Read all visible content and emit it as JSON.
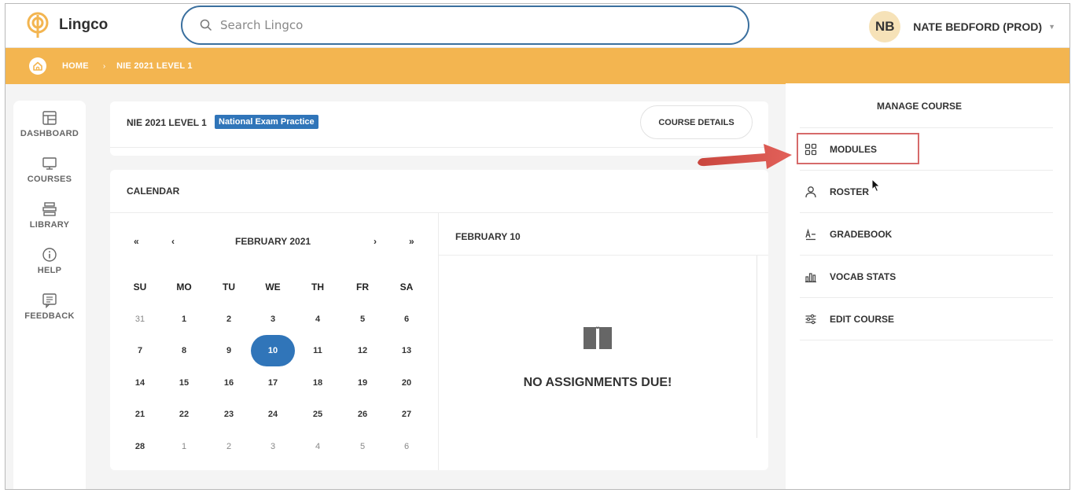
{
  "app": {
    "name": "Lingco"
  },
  "search": {
    "placeholder": "Search Lingco"
  },
  "user": {
    "initials": "NB",
    "name": "NATE BEDFORD (PROD)"
  },
  "breadcrumb": {
    "home": "HOME",
    "current": "NIE 2021 LEVEL 1"
  },
  "sidebar": {
    "items": [
      {
        "label": "DASHBOARD",
        "icon": "dashboard-icon"
      },
      {
        "label": "COURSES",
        "icon": "courses-icon"
      },
      {
        "label": "LIBRARY",
        "icon": "library-icon"
      },
      {
        "label": "HELP",
        "icon": "help-icon"
      },
      {
        "label": "FEEDBACK",
        "icon": "feedback-icon"
      }
    ]
  },
  "course": {
    "title": "NIE 2021 LEVEL 1",
    "badge": "National Exam Practice",
    "details_button": "COURSE DETAILS"
  },
  "calendar": {
    "title": "CALENDAR",
    "month": "FEBRUARY 2021",
    "nav": {
      "first": "«",
      "prev": "‹",
      "next": "›",
      "last": "»"
    },
    "weekdays": [
      "SU",
      "MO",
      "TU",
      "WE",
      "TH",
      "FR",
      "SA"
    ],
    "weeks": [
      [
        "31",
        "1",
        "2",
        "3",
        "4",
        "5",
        "6"
      ],
      [
        "7",
        "8",
        "9",
        "10",
        "11",
        "12",
        "13"
      ],
      [
        "14",
        "15",
        "16",
        "17",
        "18",
        "19",
        "20"
      ],
      [
        "21",
        "22",
        "23",
        "24",
        "25",
        "26",
        "27"
      ],
      [
        "28",
        "1",
        "2",
        "3",
        "4",
        "5",
        "6"
      ]
    ],
    "selected_date": "10",
    "selected_title": "FEBRUARY 10",
    "empty_message": "NO ASSIGNMENTS DUE!"
  },
  "manage": {
    "title": "MANAGE COURSE",
    "items": [
      {
        "label": "MODULES",
        "icon": "modules-icon"
      },
      {
        "label": "ROSTER",
        "icon": "roster-icon"
      },
      {
        "label": "GRADEBOOK",
        "icon": "gradebook-icon"
      },
      {
        "label": "VOCAB STATS",
        "icon": "vocab-stats-icon"
      },
      {
        "label": "EDIT COURSE",
        "icon": "edit-course-icon"
      }
    ]
  },
  "colors": {
    "accent": "#3075b9",
    "breadcrumb_bar": "#f3b550",
    "annotation": "#d9534f",
    "avatar_bg": "#f6e2b8"
  }
}
